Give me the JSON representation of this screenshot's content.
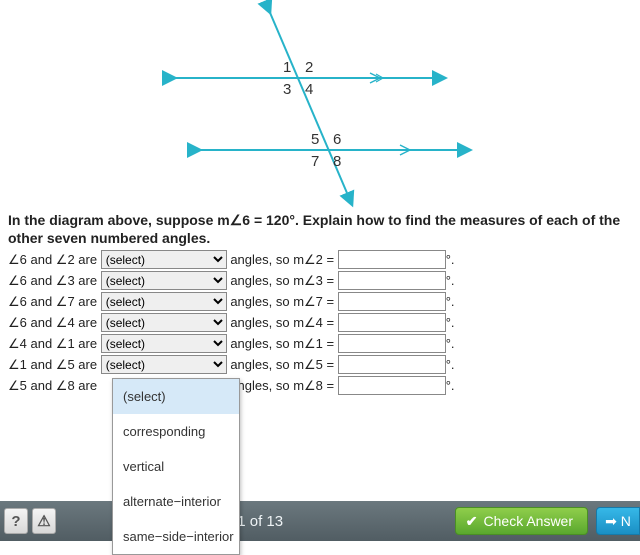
{
  "diagram": {
    "labels": [
      "1",
      "2",
      "3",
      "4",
      "5",
      "6",
      "7",
      "8"
    ]
  },
  "instructions": "In the diagram above, suppose m∠6 = 120°. Explain how to find the measures of each of the other seven numbered angles.",
  "select_placeholder": "(select)",
  "rows": [
    {
      "pair": "∠6 and ∠2 are ",
      "mid": " angles, so m∠2 = ",
      "suffix": "°."
    },
    {
      "pair": "∠6 and ∠3 are ",
      "mid": " angles, so m∠3 = ",
      "suffix": "°."
    },
    {
      "pair": "∠6 and ∠7 are ",
      "mid": " angles, so m∠7 = ",
      "suffix": "°."
    },
    {
      "pair": "∠6 and ∠4 are ",
      "mid": " angles, so m∠4 = ",
      "suffix": "°."
    },
    {
      "pair": "∠4 and ∠1 are ",
      "mid": " angles, so m∠1 = ",
      "suffix": "°."
    },
    {
      "pair": "∠1 and ∠5 are ",
      "mid": " angles, so m∠5 = ",
      "suffix": "°."
    },
    {
      "pair": "∠5 and ∠8 are ",
      "mid": " angles, so m∠8 = ",
      "suffix": "°."
    }
  ],
  "dropdown": {
    "options": [
      "(select)",
      "corresponding",
      "vertical",
      "alternate−interior",
      "same−side−interior"
    ]
  },
  "footer": {
    "help": "?",
    "warn": "⚠",
    "step": "11 of 13",
    "check": "Check Answer",
    "next": "N"
  }
}
